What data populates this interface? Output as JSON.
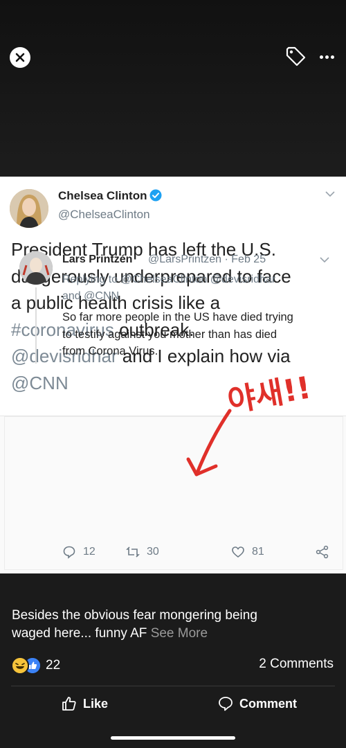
{
  "header": {
    "close_icon": "close-icon",
    "tag_icon": "tag-icon",
    "more_icon": "more-dots-icon"
  },
  "tweet": {
    "name": "Chelsea Clinton",
    "handle": "@ChelseaClinton",
    "text_line1": "President Trump has left the U.S.",
    "text_line2": "dangerously underprepared to face",
    "text_line3": "a public health crisis like a",
    "hashtag": "#coronavirus",
    "text_line4_rest": " outbreak.",
    "mention1": "@devisridhar",
    "text_line5_rest": " and I explain how via",
    "mention2": "@CNN"
  },
  "stamp_text": "야새!!",
  "reply": {
    "name": "Lars Printzén",
    "meta": "@LarsPrintzen · Feb 25",
    "replying_line1": "Replying to @ChelseaClinton @devisridhar",
    "replying_line2": "and @CNN",
    "body_line1": "So far more people in the US have died trying",
    "body_line2": "to testify against you mother than has died",
    "body_line3": "from Corona Virus.",
    "replies": "12",
    "retweets": "30",
    "likes": "81"
  },
  "post": {
    "caption_line1": "Besides the obvious fear mongering being",
    "caption_line2": "waged here... funny AF ",
    "see_more": "See More",
    "reaction_count": "22",
    "comments": "2 Comments",
    "like_label": "Like",
    "comment_label": "Comment"
  },
  "colors": {
    "background": "#1b1b1b",
    "verified": "#1da1f2",
    "stamp_red": "#e0302a"
  }
}
